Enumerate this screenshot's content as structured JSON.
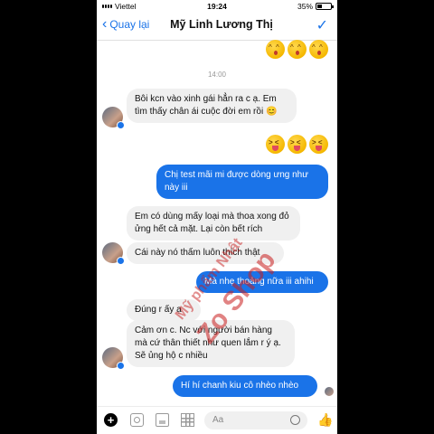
{
  "status_bar": {
    "carrier": "Viettel",
    "time": "19:24",
    "battery": "35%"
  },
  "header": {
    "back_label": "Quay lại",
    "title": "Mỹ Linh Lương Thị"
  },
  "timestamp": "14:00",
  "messages": [
    {
      "from": "them",
      "text": "Bôi kcn vào xinh gái hẳn ra c ạ. Em tìm thấy chân ái cuộc đời em rồi 😊"
    },
    {
      "from": "me",
      "text": "Chị test mãi mi được dòng ưng như này iii"
    },
    {
      "from": "them",
      "text": "Em có dùng mấy loại mà thoa xong đỏ ửng hết cả mặt. Lại còn bết rích"
    },
    {
      "from": "them",
      "text": "Cái này nó thấm luôn thích thật"
    },
    {
      "from": "me",
      "text": "Mà nhẹ thoảng nữa iii ahihi"
    },
    {
      "from": "them",
      "text": "Đúng r ấy ạ"
    },
    {
      "from": "them",
      "text": "Cảm ơn c. Nc với người bán hàng mà cứ thân thiết như quen lắm r ý ạ. Sẽ ủng hộ c nhiều"
    },
    {
      "from": "me",
      "text": "Hí hí chanh kiu cô nhèo nhèo"
    }
  ],
  "watermark": {
    "line1": "Mỹ phẩm Nhật",
    "line2": "Zo Shop"
  },
  "composer": {
    "placeholder": "Aa"
  },
  "colors": {
    "accent": "#1a73e8",
    "incoming": "#f0f0f0"
  }
}
